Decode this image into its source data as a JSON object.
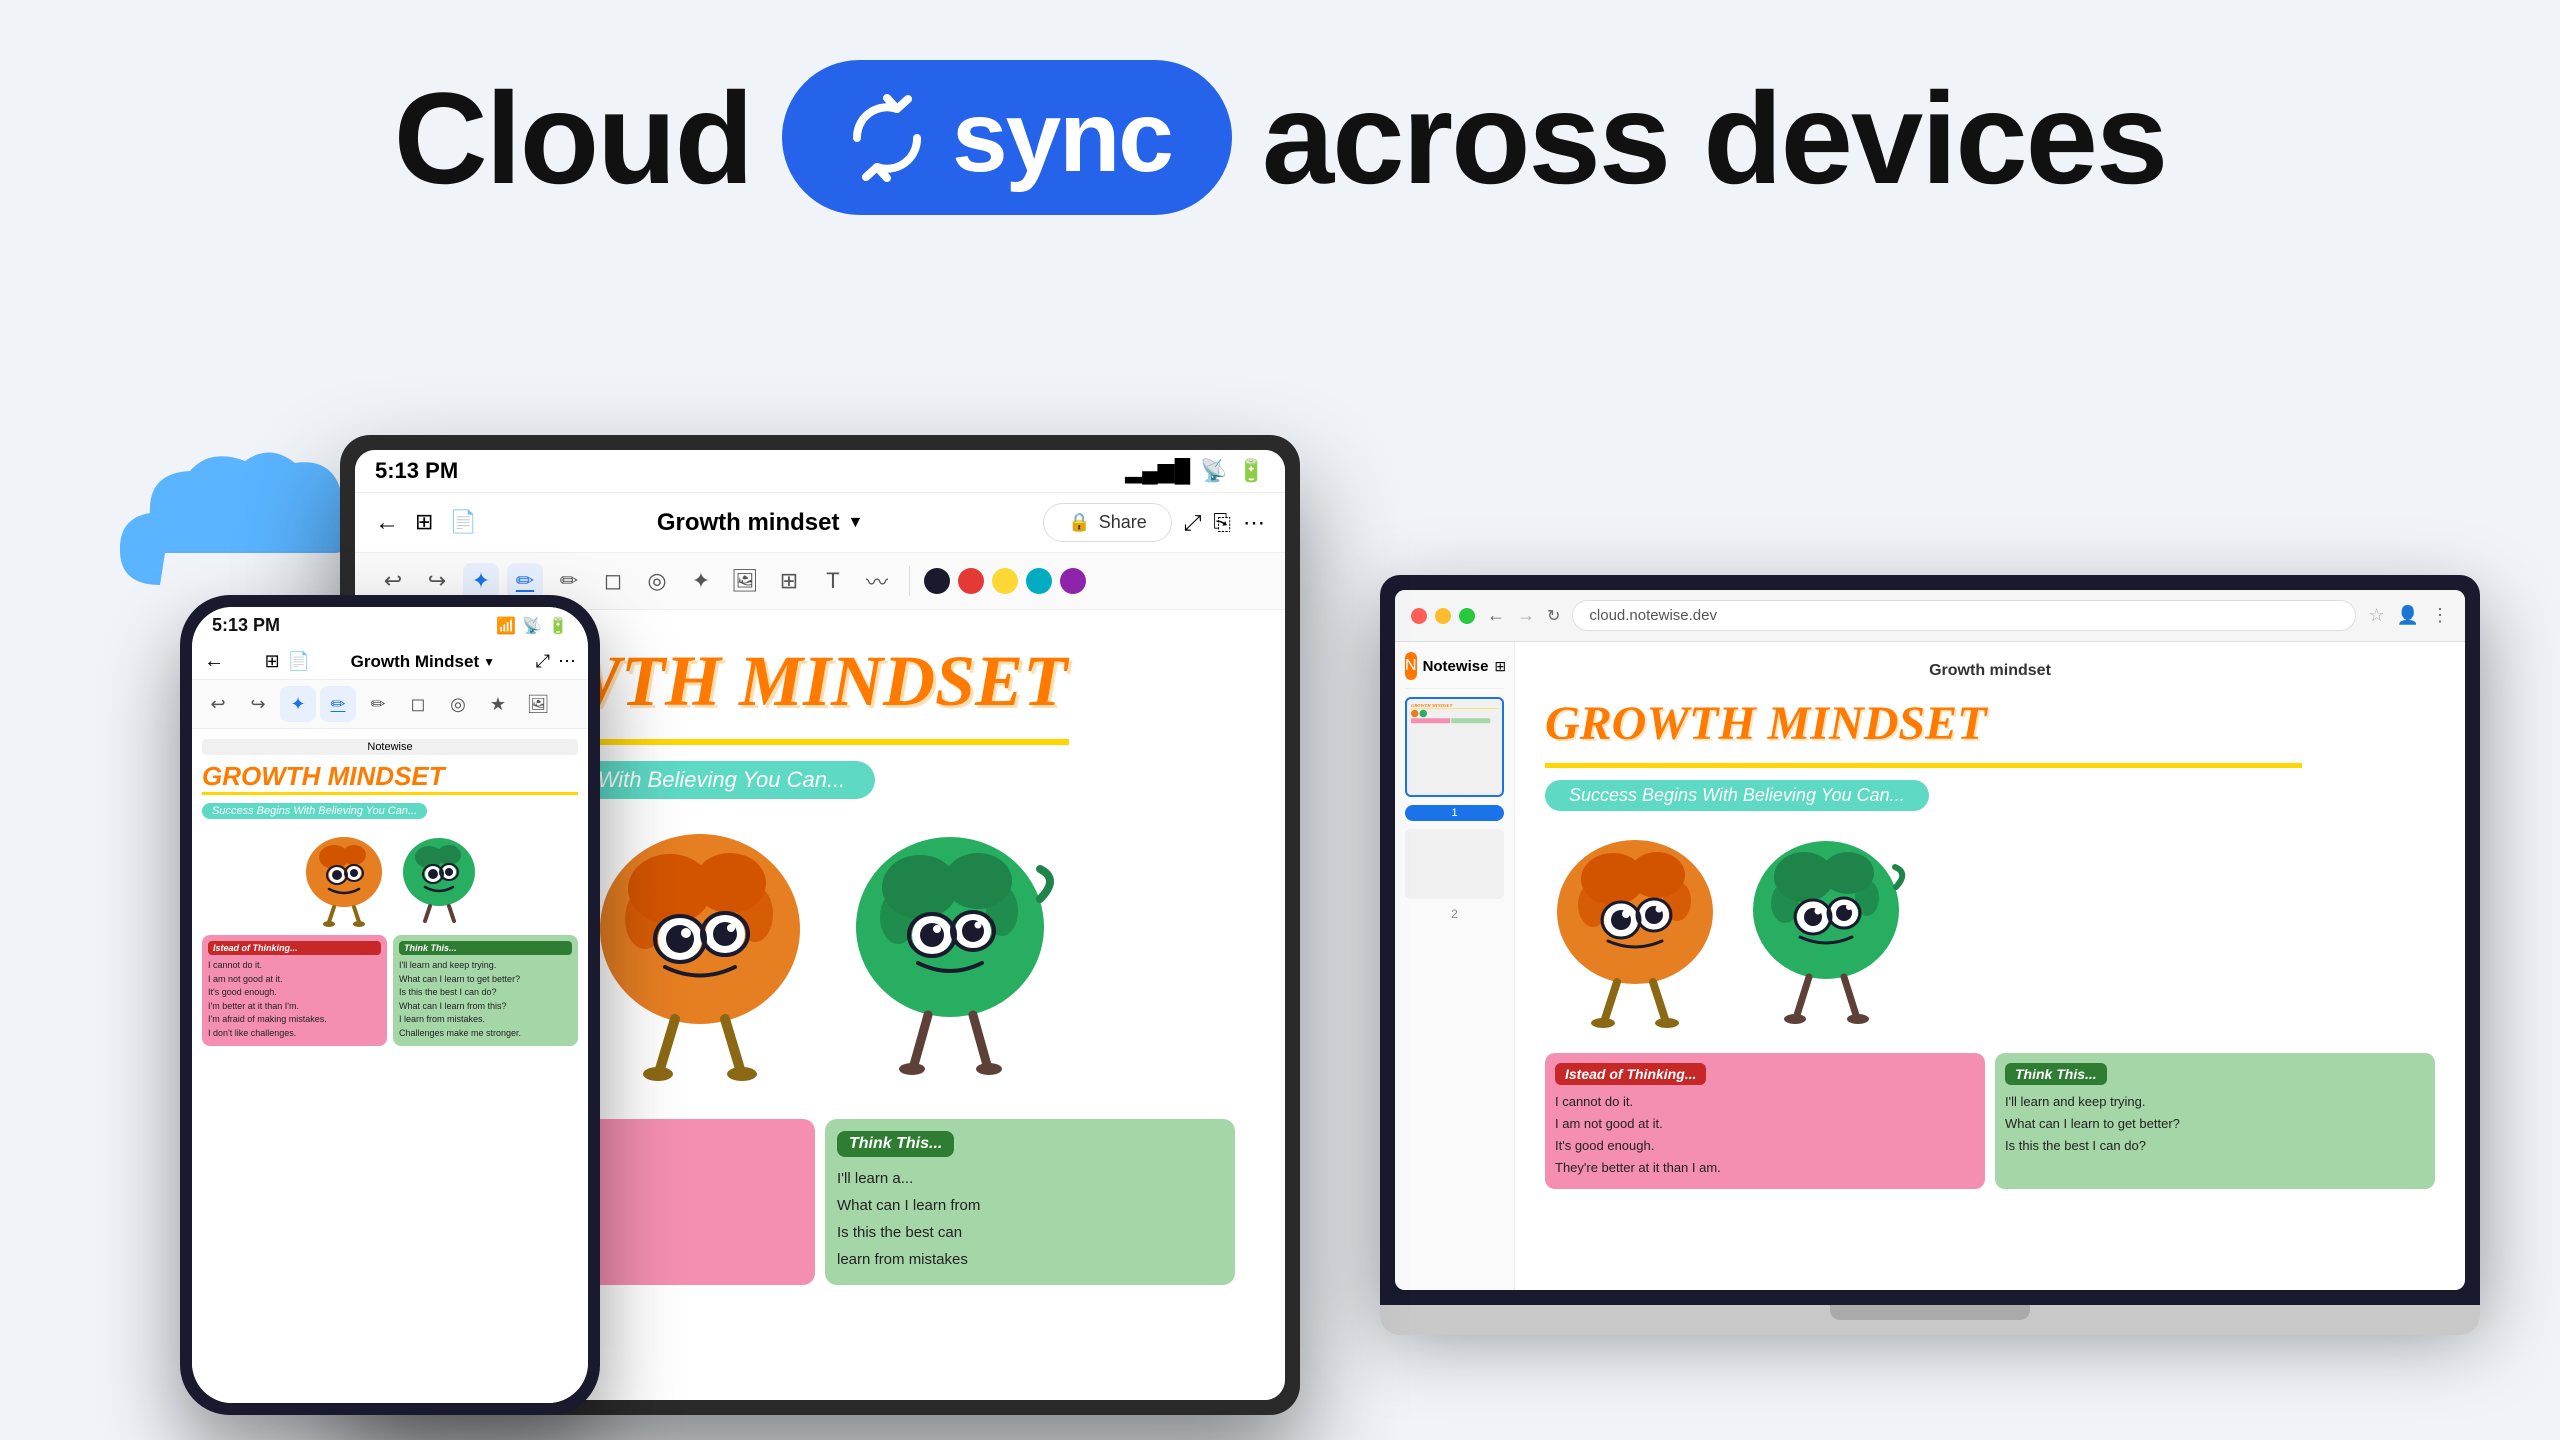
{
  "header": {
    "prefix": "Cloud",
    "badge_text": "sync",
    "suffix": "across devices"
  },
  "sync_icon": "🔄",
  "cloud_icon": "☁",
  "devices": {
    "phone": {
      "status_time": "5:13 PM",
      "title": "Growth Mindset",
      "gm_title": "GROWTH MINDSET",
      "tagline": "Success Begins With Believing You Can...",
      "card_left_title": "Istead of Thinking...",
      "card_right_title": "Think This...",
      "card_left_items": [
        "I cannot do it.",
        "I am not good at it.",
        "It's good enough.",
        "I'm better at it than I'm.",
        "I'm afraid of making mistakes.",
        "I don't like challenges."
      ],
      "card_right_items": [
        "I'll learn and keep trying.",
        "What can I learn to get better?",
        "Is this the best I can do?",
        "What can I learn from this?",
        "I learn from mistakes.",
        "Challenges make me stronger."
      ]
    },
    "tablet": {
      "status_time": "5:13 PM",
      "title": "Growth mindset",
      "gm_title": "GROWTH MINDSET",
      "tagline": "Success Begins With Believing You Can...",
      "card_left_title": "Istead of Thinking...",
      "card_right_title": "Think This...",
      "card_left_items": [
        "I cannot do it.",
        "I am not good at it."
      ],
      "card_right_items": [
        "I'll learn a..."
      ],
      "bottom_texts": [
        "What can I learn from",
        "Is this the best can",
        "learn from mistakes"
      ]
    },
    "laptop": {
      "url": "cloud.notewise.dev",
      "app_name": "Notewise",
      "document_title": "Growth mindset",
      "gm_title": "GROWTH MINDSET",
      "tagline": "Success Begins With Believing You Can...",
      "card_left_title": "Istead of Thinking...",
      "card_right_title": "Think This...",
      "card_left_items": [
        "I cannot do it.",
        "I am not good at it.",
        "It's good enough.",
        "They're better at it than I am."
      ],
      "card_right_items": [
        "I'll learn and keep trying.",
        "What can I learn to get better?",
        "Is this the best I can do?"
      ]
    }
  },
  "colors": {
    "accent_blue": "#2563eb",
    "orange": "#ff7a00",
    "teal": "#5dd9c4",
    "yellow": "#ffd700",
    "pink": "#f48fb1",
    "green_card": "#a5d6a7",
    "brain_orange": "#e67e22",
    "brain_green": "#27ae60"
  }
}
